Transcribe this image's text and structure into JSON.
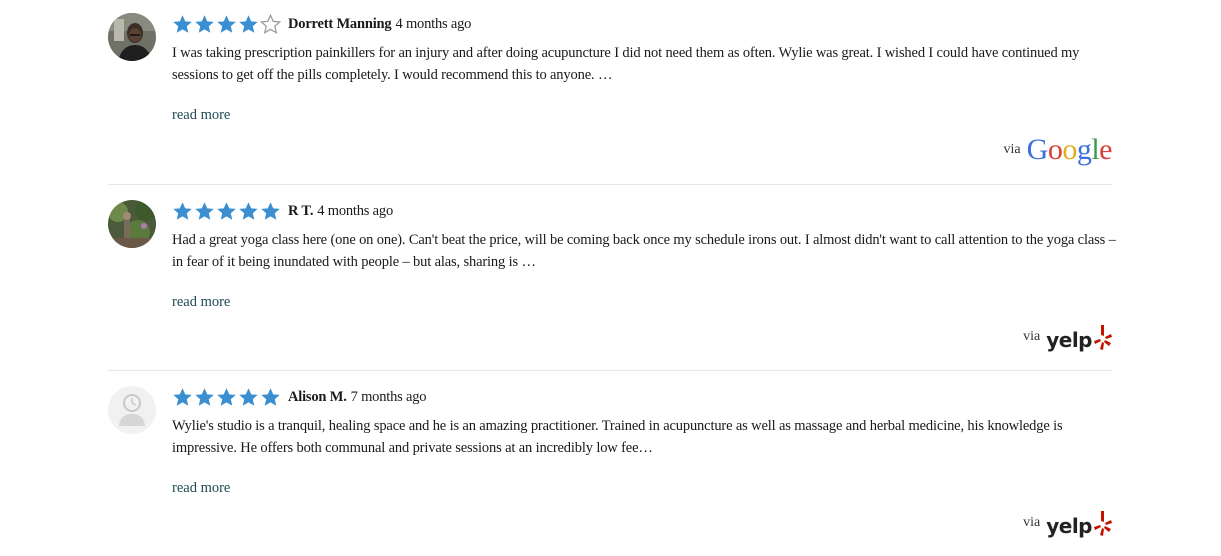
{
  "reviews": [
    {
      "author": "Dorrett Manning",
      "time": "4 months ago",
      "rating": 4,
      "text": "I was taking prescription painkillers for an injury and after doing acupuncture I did not need them as often. Wylie was great. I wished I could have continued my sessions to get off the pills completely. I would recommend this to anyone. …",
      "read_more": "read more",
      "via_label": "via",
      "source": "Google",
      "avatar": "photo-avatar"
    },
    {
      "author": "R T.",
      "time": "4 months ago",
      "rating": 5,
      "text": "Had a great yoga class here (one on one). Can't beat the price, will be coming back once my schedule irons out. I almost didn't want to call attention to the yoga class – in fear of it being inundated with people – but alas, sharing is …",
      "read_more": "read more",
      "via_label": "via",
      "source": "yelp",
      "avatar": "photo-avatar"
    },
    {
      "author": "Alison M.",
      "time": "7 months ago",
      "rating": 5,
      "text": "Wylie's studio is a tranquil, healing space and he is an amazing practitioner. Trained in acupuncture as well as massage and herbal medicine, his knowledge is impressive. He offers both communal and private sessions at an incredibly low fee…",
      "read_more": "read more",
      "via_label": "via",
      "source": "yelp",
      "avatar": "default-user-icon"
    }
  ],
  "colors": {
    "star_filled": "#3b8fd0",
    "star_empty_stroke": "#9a9a9a",
    "link": "#1e4a55",
    "yelp_red": "#c41200",
    "separator": "#e6e6e6"
  }
}
